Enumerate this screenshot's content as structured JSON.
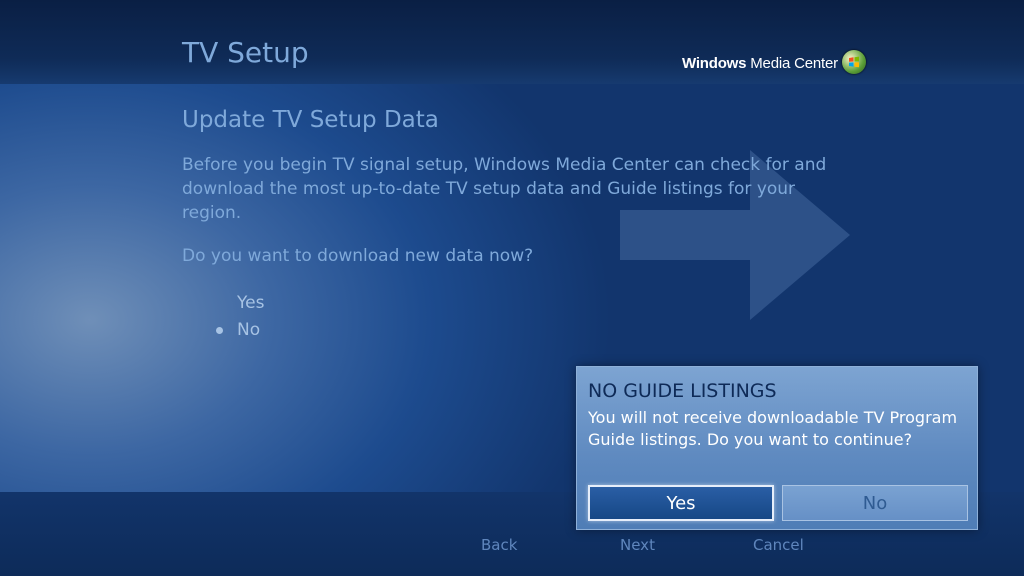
{
  "header": {
    "title": "TV Setup",
    "brand_name_bold": "Windows",
    "brand_name_rest": " Media Center",
    "brand_logo_icon": "windows-flag-icon"
  },
  "main": {
    "section_title": "Update TV Setup Data",
    "description": "Before you begin TV signal setup, Windows Media Center can check for and download the most up-to-date TV setup data and Guide listings for your region.",
    "question": "Do you want to download new data now?",
    "options": [
      {
        "label": "Yes",
        "selected": false
      },
      {
        "label": "No",
        "selected": true
      }
    ]
  },
  "footer": {
    "back_label": "Back",
    "next_label": "Next",
    "cancel_label": "Cancel"
  },
  "dialog": {
    "title": "NO GUIDE LISTINGS",
    "message": "You will not receive downloadable TV Program Guide listings. Do you want to continue?",
    "yes_label": "Yes",
    "no_label": "No",
    "focused_button": "Yes"
  },
  "colors": {
    "background": "#1d4b8e",
    "title_text": "#7fa9da",
    "dialog_background": "#6a93c6",
    "dialog_title": "#0e2a57"
  }
}
